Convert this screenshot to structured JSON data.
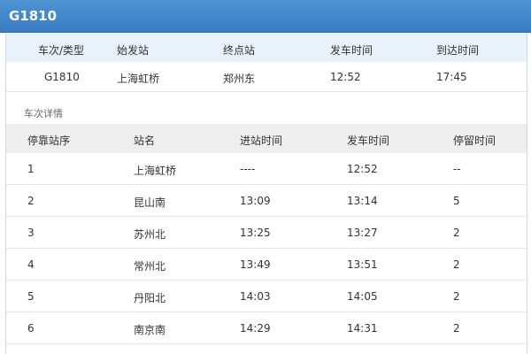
{
  "header": {
    "title": "G1810"
  },
  "summary": {
    "columns": [
      "车次/类型",
      "始发站",
      "终点站",
      "发车时间",
      "到达时间"
    ],
    "row": [
      "G1810",
      "上海虹桥",
      "郑州东",
      "12:52",
      "17:45"
    ]
  },
  "details": {
    "label": "车次详情",
    "columns": [
      "停靠站序",
      "站名",
      "进站时间",
      "发车时间",
      "停留时间"
    ],
    "rows": [
      [
        "1",
        "上海虹桥",
        "----",
        "12:52",
        "--"
      ],
      [
        "2",
        "昆山南",
        "13:09",
        "13:14",
        "5"
      ],
      [
        "3",
        "苏州北",
        "13:25",
        "13:27",
        "2"
      ],
      [
        "4",
        "常州北",
        "13:49",
        "13:51",
        "2"
      ],
      [
        "5",
        "丹阳北",
        "14:03",
        "14:05",
        "2"
      ],
      [
        "6",
        "南京南",
        "14:29",
        "14:31",
        "2"
      ]
    ]
  }
}
